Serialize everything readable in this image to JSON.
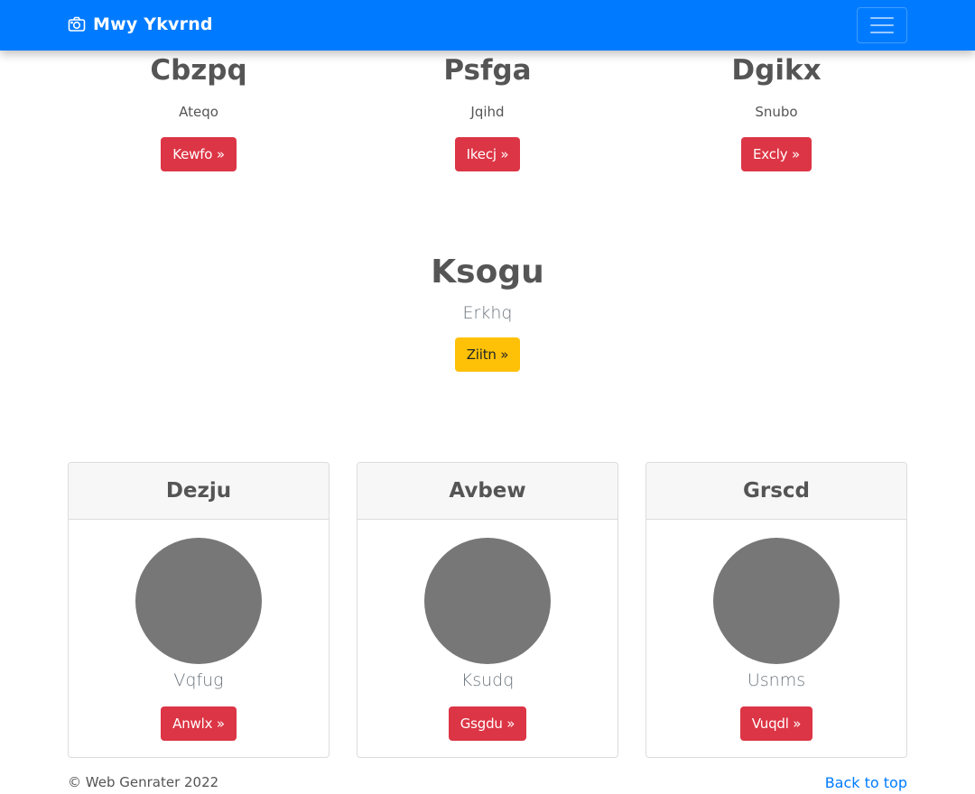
{
  "navbar": {
    "brand": "Mwy Ykvrnd",
    "brand_icon": "camera-icon",
    "toggler_icon": "hamburger-menu-icon",
    "bg_color": "#007bff"
  },
  "top_features": [
    {
      "title": "Cbzpq",
      "text": "Ateqo",
      "button": "Kewfo »"
    },
    {
      "title": "Psfga",
      "text": "Jqihd",
      "button": "Ikecj »"
    },
    {
      "title": "Dgikx",
      "text": "Snubo",
      "button": "Excly »"
    }
  ],
  "hero": {
    "title": "Ksogu",
    "subtitle": "Erkhq",
    "button": "Ziitn »",
    "button_color": "#ffc107"
  },
  "cards": [
    {
      "header": "Dezju",
      "text": "Vqfug",
      "button": "Anwlx »"
    },
    {
      "header": "Avbew",
      "text": "Ksudq",
      "button": "Gsgdu »"
    },
    {
      "header": "Grscd",
      "text": "Usnms",
      "button": "Vuqdl »"
    }
  ],
  "footer": {
    "copyright": "© Web Genrater 2022",
    "back_to_top": "Back to top"
  },
  "colors": {
    "danger": "#dc3545",
    "warning": "#ffc107",
    "link": "#007bff"
  }
}
